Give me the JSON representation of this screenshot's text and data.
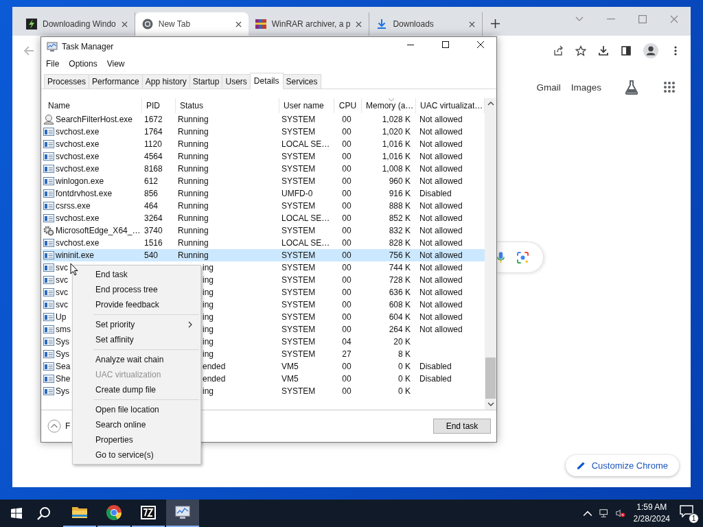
{
  "browser": {
    "tabs": [
      {
        "title": "Downloading Windo",
        "selected": false
      },
      {
        "title": "New Tab",
        "selected": true
      },
      {
        "title": "WinRAR archiver, a p",
        "selected": false
      },
      {
        "title": "Downloads",
        "selected": false
      }
    ],
    "links": [
      "Gmail",
      "Images"
    ],
    "customize_button": "Customize Chrome"
  },
  "task_manager": {
    "title": "Task Manager",
    "menu": [
      "File",
      "Options",
      "View"
    ],
    "tabs": [
      {
        "label": "Processes",
        "selected": false
      },
      {
        "label": "Performance",
        "selected": false
      },
      {
        "label": "App history",
        "selected": false
      },
      {
        "label": "Startup",
        "selected": false
      },
      {
        "label": "Users",
        "selected": false
      },
      {
        "label": "Details",
        "selected": true
      },
      {
        "label": "Services",
        "selected": false
      }
    ],
    "columns": [
      "Name",
      "PID",
      "Status",
      "User name",
      "CPU",
      "Memory (a…",
      "UAC virtualizat…"
    ],
    "rows": [
      {
        "kind": "indexer",
        "name": "SearchFilterHost.exe",
        "pid": "1672",
        "status": "Running",
        "user": "SYSTEM",
        "cpu": "00",
        "memory": "1,028 K",
        "uac": "Not allowed",
        "selected": false
      },
      {
        "kind": "process",
        "name": "svchost.exe",
        "pid": "1764",
        "status": "Running",
        "user": "SYSTEM",
        "cpu": "00",
        "memory": "1,020 K",
        "uac": "Not allowed",
        "selected": false
      },
      {
        "kind": "process",
        "name": "svchost.exe",
        "pid": "1120",
        "status": "Running",
        "user": "LOCAL SE…",
        "cpu": "00",
        "memory": "1,016 K",
        "uac": "Not allowed",
        "selected": false
      },
      {
        "kind": "process",
        "name": "svchost.exe",
        "pid": "4564",
        "status": "Running",
        "user": "SYSTEM",
        "cpu": "00",
        "memory": "1,016 K",
        "uac": "Not allowed",
        "selected": false
      },
      {
        "kind": "process",
        "name": "svchost.exe",
        "pid": "8168",
        "status": "Running",
        "user": "SYSTEM",
        "cpu": "00",
        "memory": "1,008 K",
        "uac": "Not allowed",
        "selected": false
      },
      {
        "kind": "process",
        "name": "winlogon.exe",
        "pid": "612",
        "status": "Running",
        "user": "SYSTEM",
        "cpu": "00",
        "memory": "960 K",
        "uac": "Not allowed",
        "selected": false
      },
      {
        "kind": "process",
        "name": "fontdrvhost.exe",
        "pid": "856",
        "status": "Running",
        "user": "UMFD-0",
        "cpu": "00",
        "memory": "916 K",
        "uac": "Disabled",
        "selected": false
      },
      {
        "kind": "process",
        "name": "csrss.exe",
        "pid": "464",
        "status": "Running",
        "user": "SYSTEM",
        "cpu": "00",
        "memory": "888 K",
        "uac": "Not allowed",
        "selected": false
      },
      {
        "kind": "process",
        "name": "svchost.exe",
        "pid": "3264",
        "status": "Running",
        "user": "LOCAL SE…",
        "cpu": "00",
        "memory": "852 K",
        "uac": "Not allowed",
        "selected": false
      },
      {
        "kind": "installer",
        "name": "MicrosoftEdge_X64_…",
        "pid": "3740",
        "status": "Running",
        "user": "SYSTEM",
        "cpu": "00",
        "memory": "832 K",
        "uac": "Not allowed",
        "selected": false
      },
      {
        "kind": "process",
        "name": "svchost.exe",
        "pid": "1516",
        "status": "Running",
        "user": "LOCAL SE…",
        "cpu": "00",
        "memory": "828 K",
        "uac": "Not allowed",
        "selected": false
      },
      {
        "kind": "process",
        "name": "wininit.exe",
        "pid": "540",
        "status": "Running",
        "user": "SYSTEM",
        "cpu": "00",
        "memory": "756 K",
        "uac": "Not allowed",
        "selected": true
      },
      {
        "kind": "process",
        "name": "svc",
        "status": "ing",
        "user": "SYSTEM",
        "cpu": "00",
        "memory": "744 K",
        "uac": "Not allowed",
        "selected": false
      },
      {
        "kind": "process",
        "name": "svc",
        "status": "ing",
        "user": "SYSTEM",
        "cpu": "00",
        "memory": "728 K",
        "uac": "Not allowed",
        "selected": false
      },
      {
        "kind": "process",
        "name": "svc",
        "status": "ing",
        "user": "SYSTEM",
        "cpu": "00",
        "memory": "636 K",
        "uac": "Not allowed",
        "selected": false
      },
      {
        "kind": "process",
        "name": "svc",
        "status": "ing",
        "user": "SYSTEM",
        "cpu": "00",
        "memory": "608 K",
        "uac": "Not allowed",
        "selected": false
      },
      {
        "kind": "process",
        "name": "Up",
        "status": "ing",
        "user": "SYSTEM",
        "cpu": "00",
        "memory": "604 K",
        "uac": "Not allowed",
        "selected": false
      },
      {
        "kind": "process",
        "name": "sms",
        "status": "ing",
        "user": "SYSTEM",
        "cpu": "00",
        "memory": "264 K",
        "uac": "Not allowed",
        "selected": false
      },
      {
        "kind": "process",
        "name": "Sys",
        "status": "ing",
        "user": "SYSTEM",
        "cpu": "04",
        "memory": "20 K",
        "selected": false
      },
      {
        "kind": "process",
        "name": "Sys",
        "status": "ing",
        "user": "SYSTEM",
        "cpu": "27",
        "memory": "8 K",
        "selected": false
      },
      {
        "kind": "process",
        "name": "Sea",
        "status": "ended",
        "user": "VM5",
        "cpu": "00",
        "memory": "0 K",
        "uac": "Disabled",
        "selected": false
      },
      {
        "kind": "process",
        "name": "She",
        "status": "ended",
        "user": "VM5",
        "cpu": "00",
        "memory": "0 K",
        "uac": "Disabled",
        "selected": false
      },
      {
        "kind": "process",
        "name": "Sys",
        "status": "ing",
        "user": "SYSTEM",
        "cpu": "00",
        "memory": "0 K",
        "selected": false
      }
    ],
    "footer_label": "F",
    "end_task_button": "End task"
  },
  "context_menu": {
    "items": [
      {
        "kind": "item",
        "label": "End task",
        "disabled": false
      },
      {
        "kind": "item",
        "label": "End process tree",
        "disabled": false
      },
      {
        "kind": "item",
        "label": "Provide feedback",
        "disabled": false
      },
      {
        "kind": "separator"
      },
      {
        "kind": "submenu",
        "label": "Set priority",
        "disabled": false
      },
      {
        "kind": "item",
        "label": "Set affinity",
        "disabled": false
      },
      {
        "kind": "separator"
      },
      {
        "kind": "item",
        "label": "Analyze wait chain",
        "disabled": false
      },
      {
        "kind": "item",
        "label": "UAC virtualization",
        "disabled": true
      },
      {
        "kind": "item",
        "label": "Create dump file",
        "disabled": false
      },
      {
        "kind": "separator"
      },
      {
        "kind": "item",
        "label": "Open file location",
        "disabled": false
      },
      {
        "kind": "item",
        "label": "Search online",
        "disabled": false
      },
      {
        "kind": "item",
        "label": "Properties",
        "disabled": false
      },
      {
        "kind": "item",
        "label": "Go to service(s)",
        "disabled": false
      }
    ]
  },
  "taskbar": {
    "apps": [
      {
        "selected": false
      },
      {
        "selected": false
      },
      {
        "selected": false
      },
      {
        "selected": true
      }
    ],
    "time": "1:59 AM",
    "date": "2/28/2024",
    "notification_count": "1"
  }
}
